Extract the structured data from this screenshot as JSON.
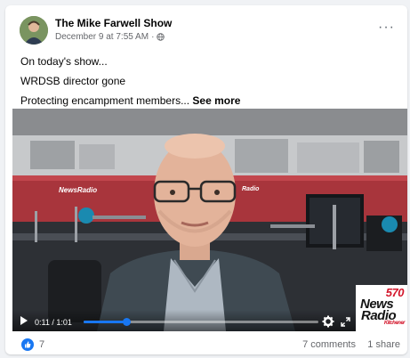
{
  "post": {
    "author": "The Mike Farwell Show",
    "date": "December 9 at 7:55 AM",
    "separator": "·",
    "privacy_icon": "globe-icon",
    "menu_icon": "more-horizontal-icon",
    "menu_label": "···",
    "text_lines": [
      "On today's show...",
      "WRDSB director gone",
      "Protecting encampment members..."
    ],
    "see_more": "See more"
  },
  "video": {
    "time": "0:11 / 1:01",
    "progress": 0.18,
    "watermark": {
      "number": "570",
      "line1": "News",
      "line2": "Radio",
      "line3": "Kitchener"
    },
    "background_signs": [
      "NewsRadio",
      "Radio"
    ],
    "accent_color": "#1877f2",
    "brand_red": "#d3162b"
  },
  "footer": {
    "likes": "7",
    "comments": "7 comments",
    "shares": "1 share"
  }
}
